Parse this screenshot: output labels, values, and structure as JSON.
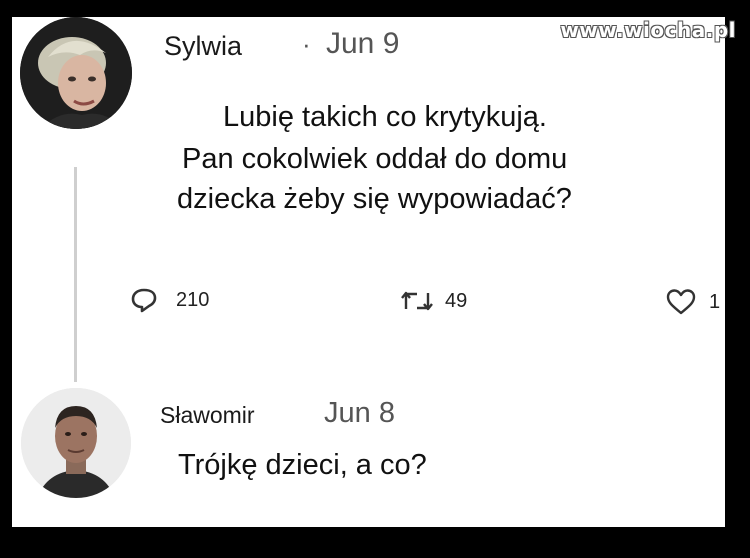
{
  "watermark": "www.wiocha.pl",
  "tweet": {
    "author": "Sylwia",
    "separator": "·",
    "date": "Jun 9",
    "lines": [
      "Lubię takich co krytykują.",
      "Pan cokolwiek oddał do domu",
      "dziecka żeby się wypowiadać?"
    ],
    "replies": "210",
    "retweets": "49",
    "likes": "1"
  },
  "reply": {
    "author": "Sławomir",
    "date": "Jun 8",
    "text": "Trójkę dzieci, a co?"
  },
  "colors": {
    "background": "#000000",
    "card": "#ffffff",
    "icon": "#333333",
    "thread_line": "#cfcfcf"
  },
  "icons": [
    "reply-icon",
    "retweet-icon",
    "like-icon"
  ]
}
